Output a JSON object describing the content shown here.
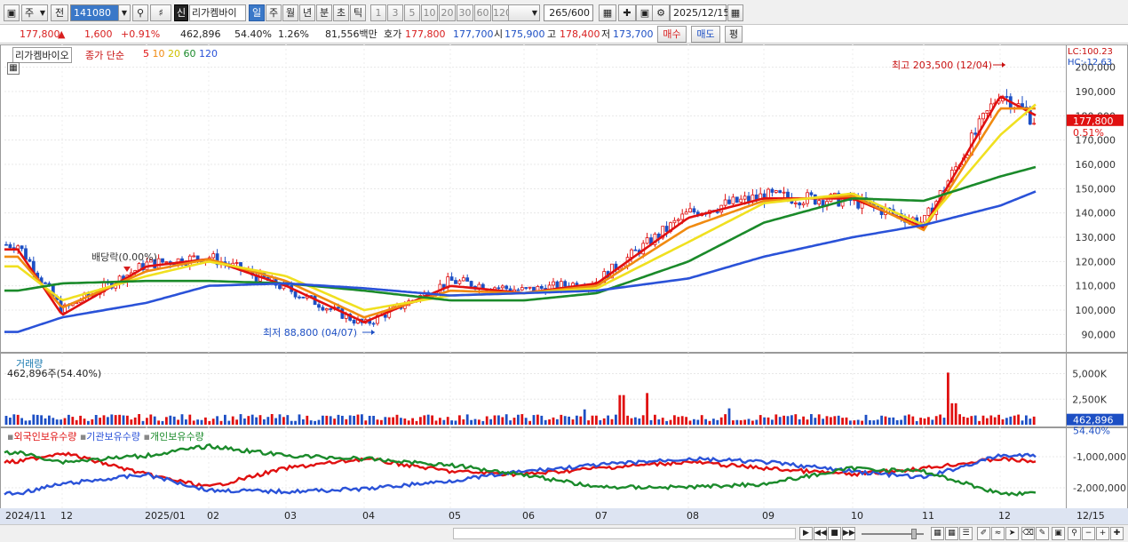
{
  "toolbar": {
    "market_type": "주",
    "period_type": "전",
    "code": "141080",
    "listed_badge": "신",
    "stock_name": "리가켐바이",
    "period_tabs": [
      "일",
      "주",
      "월",
      "년",
      "분",
      "초",
      "틱"
    ],
    "active_period": "일",
    "interval_tabs": [
      "1",
      "3",
      "5",
      "10",
      "20",
      "30",
      "60",
      "120"
    ],
    "count_value": "265",
    "count_total": "/600",
    "date": "2025/12/15"
  },
  "quote": {
    "price": "177,800",
    "change_arrow": "▲",
    "change": "1,600",
    "change_rate": "+0.91%",
    "volume": "462,896",
    "volume_ratio": "54.40%",
    "turnover": "1.26%",
    "trade_amount": "81,556백만",
    "quote_label": "호가",
    "ask": "177,800",
    "bid": "177,700",
    "open_label": "시",
    "open": "175,900",
    "high_label": "고",
    "high": "178,400",
    "low_label": "저",
    "low": "173,700",
    "buy_label": "매수",
    "sell_label": "매도",
    "avg_label": "평"
  },
  "price_panel": {
    "stock_label": "리가켐바이오",
    "ma_label": "종가 단순",
    "ma_periods": [
      "5",
      "10",
      "20",
      "60",
      "120"
    ],
    "ma_colors": [
      "#e01010",
      "#f08a10",
      "#f0e020",
      "#1a8a2a",
      "#2a52d8"
    ],
    "lc": "LC:100.23",
    "hc": "HC:-12.63",
    "y_ticks": [
      "200,000",
      "190,000",
      "180,000",
      "170,000",
      "160,000",
      "150,000",
      "140,000",
      "130,000",
      "120,000",
      "110,000",
      "100,000",
      "90,000"
    ],
    "current_price_tag": "177,800",
    "current_pct_tag": "0.51%",
    "high_annotation": "최고 203,500 (12/04)",
    "low_annotation": "최저 88,800 (04/07)",
    "dividend_annotation": "배당락(0.00%)"
  },
  "volume_panel": {
    "title": "거래량",
    "value_label": "462,896주(54.40%)",
    "y_ticks": [
      "5,000K",
      "2,500K"
    ],
    "current_tag": "462,896",
    "current_pct": "54.40%"
  },
  "holdings_panel": {
    "labels": [
      "외국인보유수량",
      "기관보유수량",
      "개인보유수량"
    ],
    "colors": [
      "#e01010",
      "#2a52d8",
      "#1a8a2a"
    ],
    "y_ticks": [
      "-1,000,000",
      "-2,000,000"
    ]
  },
  "x_axis": {
    "labels": [
      "2024/11",
      "12",
      "2025/01",
      "02",
      "03",
      "04",
      "05",
      "06",
      "07",
      "08",
      "09",
      "10",
      "11",
      "12"
    ],
    "end_label": "12/15"
  },
  "chart_data": {
    "type": "candlestick",
    "title": "리가켐바이오",
    "ylim": [
      85000,
      205000
    ],
    "x_range": [
      "2024/11",
      "2025/12/15"
    ],
    "annotations": {
      "high": {
        "label": "최고 203,500 (12/04)",
        "value": 203500,
        "date": "12/04"
      },
      "low": {
        "label": "최저 88,800 (04/07)",
        "value": 88800,
        "date": "04/07"
      }
    },
    "close_series_approx": {
      "dates": [
        "2024/11",
        "12",
        "2025/01",
        "02",
        "03",
        "04",
        "05",
        "06",
        "07",
        "08",
        "09",
        "10",
        "11",
        "12",
        "12/15"
      ],
      "close": [
        127000,
        100000,
        119000,
        122000,
        109000,
        94000,
        112000,
        108000,
        112000,
        140000,
        147000,
        145000,
        136000,
        190000,
        177800
      ]
    },
    "series": [
      {
        "name": "5",
        "color": "#e01010",
        "values": [
          125000,
          98000,
          118000,
          121000,
          110000,
          95000,
          110000,
          107000,
          111000,
          138000,
          146000,
          146000,
          134000,
          188000,
          180000
        ]
      },
      {
        "name": "10",
        "color": "#f08a10",
        "values": [
          122000,
          101000,
          116000,
          121000,
          112000,
          97000,
          108000,
          107000,
          110000,
          134000,
          145000,
          147000,
          133000,
          183000,
          183000
        ]
      },
      {
        "name": "20",
        "color": "#f0e020",
        "values": [
          118000,
          104000,
          114000,
          120000,
          114000,
          100000,
          106000,
          107000,
          109000,
          128000,
          144000,
          148000,
          135000,
          172000,
          185000
        ]
      },
      {
        "name": "60",
        "color": "#1a8a2a",
        "values": [
          108000,
          111000,
          112000,
          112000,
          111000,
          108000,
          104000,
          104000,
          107000,
          120000,
          136000,
          146000,
          145000,
          155000,
          159000
        ]
      },
      {
        "name": "120",
        "color": "#2a52d8",
        "values": [
          91000,
          97000,
          103000,
          110000,
          111000,
          109000,
          106000,
          107000,
          108000,
          113000,
          122000,
          130000,
          135000,
          143000,
          149000
        ]
      }
    ],
    "volume": {
      "current": 462896,
      "ylim": [
        0,
        6000000
      ]
    }
  }
}
